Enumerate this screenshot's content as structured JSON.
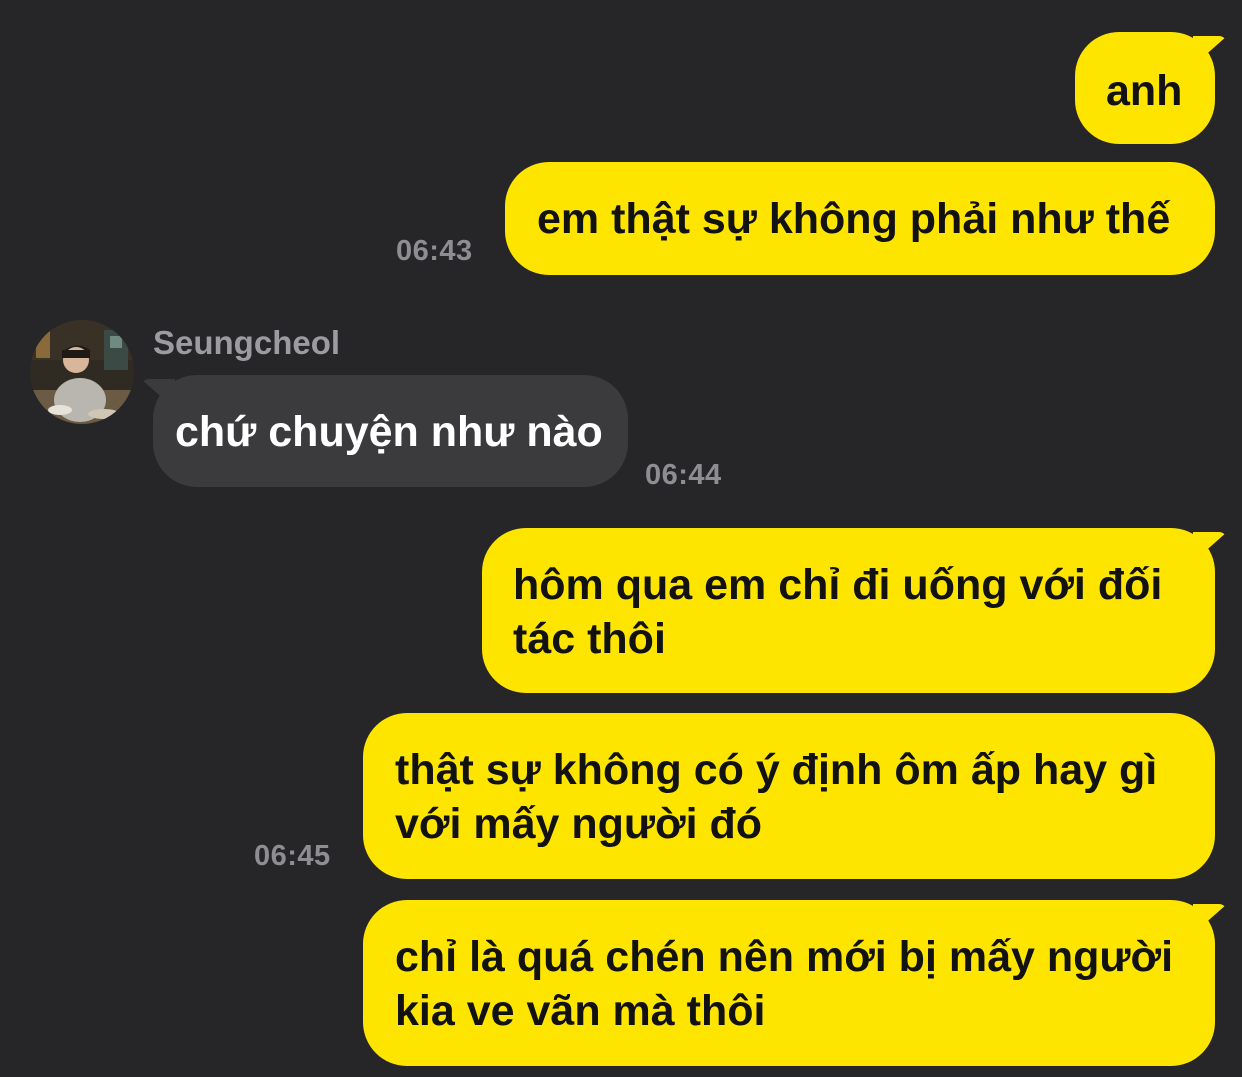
{
  "colors": {
    "background": "#262628",
    "outgoing_bubble": "#FEE500",
    "incoming_bubble": "#3B3B3D",
    "timestamp": "#8E8E92"
  },
  "contact": {
    "name": "Seungcheol",
    "avatar_icon": "profile-photo"
  },
  "messages": [
    {
      "direction": "out",
      "text": "anh"
    },
    {
      "direction": "out",
      "text": "em thật sự không phải như thế",
      "time": "06:43"
    },
    {
      "direction": "in",
      "text": "chứ chuyện như nào",
      "time": "06:44"
    },
    {
      "direction": "out",
      "text": "hôm qua em chỉ đi uống với đối\ntác thôi"
    },
    {
      "direction": "out",
      "text": "thật sự không có ý định ôm ấp hay gì\nvới mấy người đó",
      "time": "06:45"
    },
    {
      "direction": "out",
      "text": "chỉ là quá chén nên mới bị mấy người\nkia ve vãn mà thôi"
    }
  ]
}
